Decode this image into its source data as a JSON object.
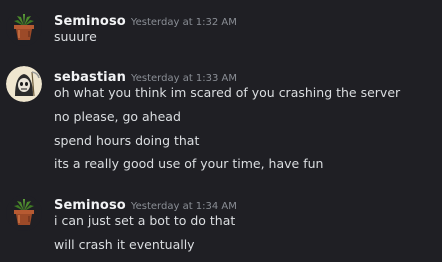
{
  "messages": [
    {
      "username": "Seminoso",
      "timestamp": "Yesterday at 1:32 AM",
      "avatar_icon": "potted-plant-icon",
      "lines": [
        "suuure"
      ]
    },
    {
      "username": "sebastian",
      "timestamp": "Yesterday at 1:33 AM",
      "avatar_icon": "reaper-character-icon",
      "lines": [
        "oh what you think im scared of you crashing the server",
        "no please, go ahead",
        "spend hours doing that",
        "its a really good use of your time, have fun"
      ]
    },
    {
      "username": "Seminoso",
      "timestamp": "Yesterday at 1:34 AM",
      "avatar_icon": "potted-plant-icon",
      "lines": [
        "i can just set a bot to do that",
        "will crash it eventually"
      ]
    }
  ],
  "colors": {
    "background": "#1f1f24",
    "username": "#f2f3f5",
    "timestamp": "#8a8e95",
    "message_text": "#dbdee1"
  }
}
